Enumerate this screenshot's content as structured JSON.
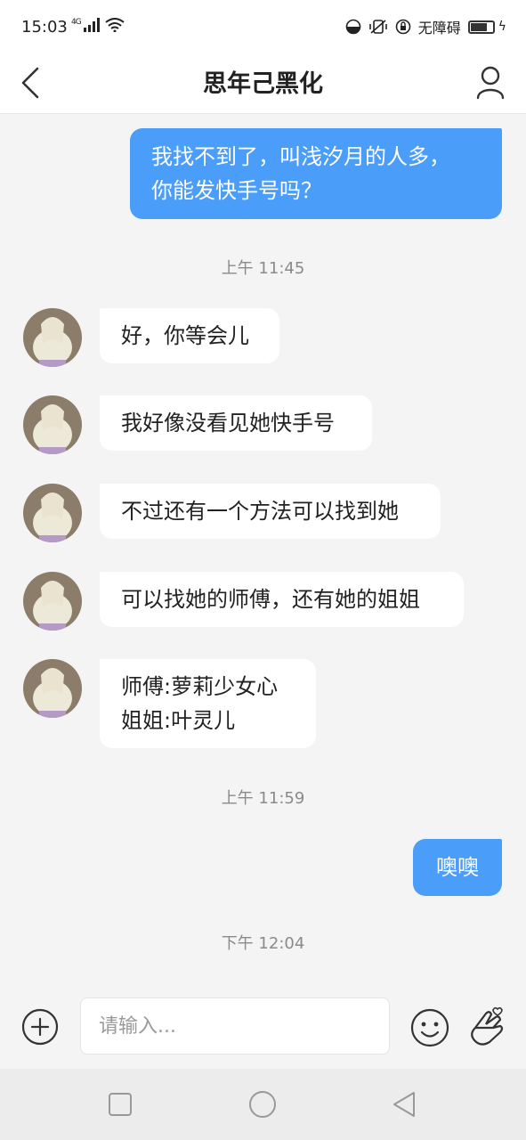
{
  "status_bar": {
    "time": "15:03",
    "signal": "4G",
    "accessibility": "无障碍",
    "icons": [
      "hd-icon",
      "mute-vibrate-icon",
      "lock-rotation-icon",
      "battery-icon"
    ]
  },
  "header": {
    "title": "思年己黑化",
    "back_icon": "back-chevron-icon",
    "profile_icon": "person-icon"
  },
  "messages": [
    {
      "from": "me",
      "lines": [
        "我找不到了，叫浅汐月的人多，",
        "你能发快手号吗？"
      ]
    },
    {
      "timestamp": "上午 11:45"
    },
    {
      "from": "other",
      "lines": [
        "好，你等会儿"
      ]
    },
    {
      "from": "other",
      "lines": [
        "我好像没看见她快手号"
      ]
    },
    {
      "from": "other",
      "lines": [
        "不过还有一个方法可以找到她"
      ]
    },
    {
      "from": "other",
      "lines": [
        "可以找她的师傅，还有她的姐姐"
      ]
    },
    {
      "from": "other",
      "lines": [
        "师傅:萝莉少女心",
        "姐姐:叶灵儿"
      ]
    },
    {
      "timestamp": "上午 11:59"
    },
    {
      "from": "me",
      "lines": [
        "噢噢"
      ]
    },
    {
      "timestamp": "下午 12:04"
    }
  ],
  "input_bar": {
    "placeholder": "请输入...",
    "value": ""
  },
  "nav_bar": {
    "icons": [
      "square-icon",
      "circle-home-icon",
      "triangle-back-icon"
    ]
  },
  "colors": {
    "my_bubble": "#4a9df8",
    "other_bubble": "#ffffff",
    "background": "#f4f4f4"
  }
}
